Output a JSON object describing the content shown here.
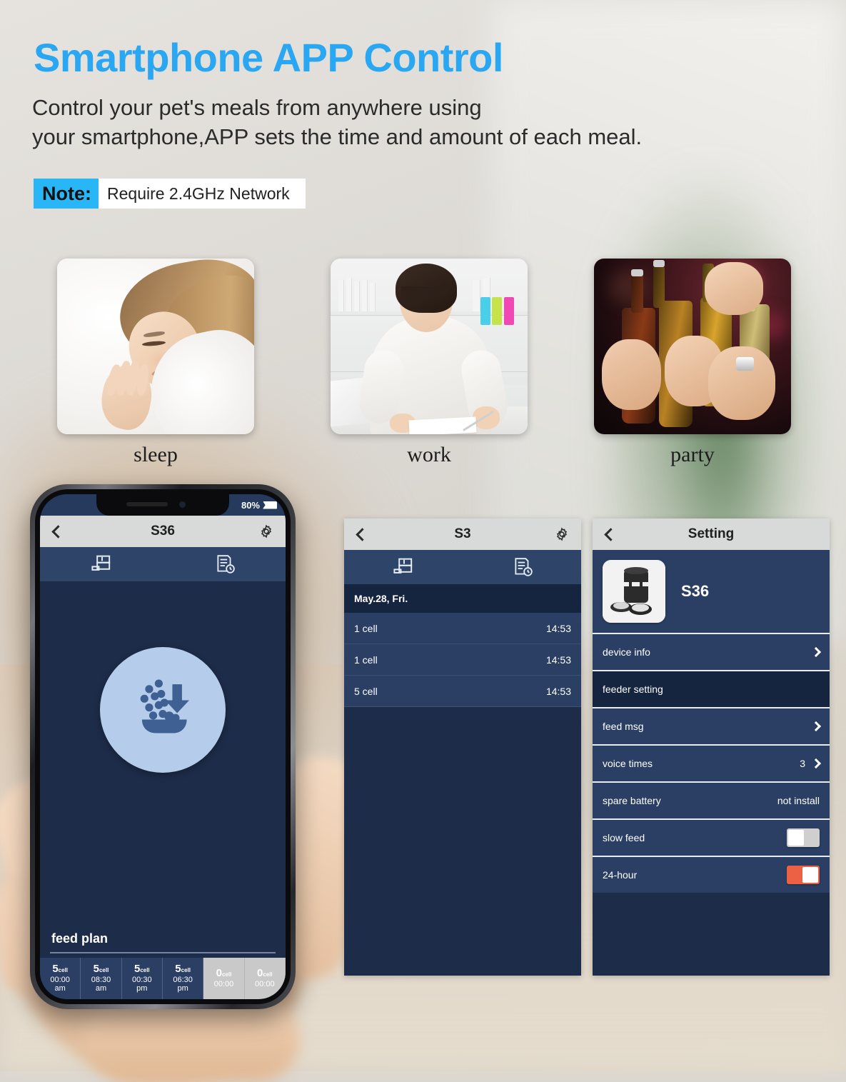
{
  "header": {
    "headline": "Smartphone APP Control",
    "subtitle_line1": "Control your pet's meals from anywhere using",
    "subtitle_line2": "your smartphone,APP sets the time and amount of each meal.",
    "note_label": "Note:",
    "note_text": "Require 2.4GHz Network",
    "headline_color": "#29a7f2",
    "note_badge_color": "#29b6f6"
  },
  "scenes": [
    {
      "id": "sleep",
      "caption": "sleep",
      "alt": "woman sleeping on white pillow"
    },
    {
      "id": "work",
      "caption": "work",
      "alt": "woman working at a desk with laptop"
    },
    {
      "id": "party",
      "caption": "party",
      "alt": "hands toasting beer bottles at a party"
    }
  ],
  "phone": {
    "status": {
      "battery": "80%"
    },
    "appbar": {
      "title": "S36",
      "back_icon": "chevron-left-icon",
      "settings_icon": "gear-icon"
    },
    "tabs": [
      {
        "id": "feeder",
        "icon": "feeder-device-icon"
      },
      {
        "id": "records",
        "icon": "feed-log-clock-icon"
      }
    ],
    "feed_button": {
      "icon": "feed-now-bowl-icon"
    },
    "feed_plan": {
      "label": "feed plan",
      "cells": [
        {
          "amount": "5",
          "unit": "cell",
          "time": "00:00",
          "meridiem": "am",
          "enabled": true
        },
        {
          "amount": "5",
          "unit": "cell",
          "time": "08:30",
          "meridiem": "am",
          "enabled": true
        },
        {
          "amount": "5",
          "unit": "cell",
          "time": "00:30",
          "meridiem": "pm",
          "enabled": true
        },
        {
          "amount": "5",
          "unit": "cell",
          "time": "06:30",
          "meridiem": "pm",
          "enabled": true
        },
        {
          "amount": "0",
          "unit": "cell",
          "time": "00:00",
          "meridiem": "",
          "enabled": false
        },
        {
          "amount": "0",
          "unit": "cell",
          "time": "00:00",
          "meridiem": "",
          "enabled": false
        }
      ]
    }
  },
  "log_panel": {
    "appbar": {
      "title": "S3",
      "back_icon": "chevron-left-icon",
      "settings_icon": "gear-icon"
    },
    "tabs": [
      {
        "id": "feeder",
        "icon": "feeder-device-icon"
      },
      {
        "id": "records",
        "icon": "feed-log-clock-icon"
      }
    ],
    "date_header": "May.28,  Fri.",
    "rows": [
      {
        "amount": "1 cell",
        "time": "14:53"
      },
      {
        "amount": "1 cell",
        "time": "14:53"
      },
      {
        "amount": "5 cell",
        "time": "14:53"
      }
    ]
  },
  "settings_panel": {
    "appbar": {
      "title": "Setting",
      "back_icon": "chevron-left-icon"
    },
    "device": {
      "name": "S36",
      "thumb_icon": "pet-feeder-product-image"
    },
    "rows": [
      {
        "id": "device-info",
        "label": "device info",
        "type": "link",
        "value": ""
      },
      {
        "id": "feeder-setting",
        "label": "feeder setting",
        "type": "section",
        "value": ""
      },
      {
        "id": "feed-msg",
        "label": "feed msg",
        "type": "link",
        "value": ""
      },
      {
        "id": "voice-times",
        "label": "voice times",
        "type": "link",
        "value": "3"
      },
      {
        "id": "spare-battery",
        "label": "spare battery",
        "type": "value",
        "value": "not install"
      },
      {
        "id": "slow-feed",
        "label": "slow feed",
        "type": "toggle",
        "value": "off"
      },
      {
        "id": "24-hour",
        "label": "24-hour",
        "type": "toggle",
        "value": "on"
      }
    ],
    "toggle_on_color": "#ec6144",
    "toggle_off_color": "#cfcfcf"
  }
}
